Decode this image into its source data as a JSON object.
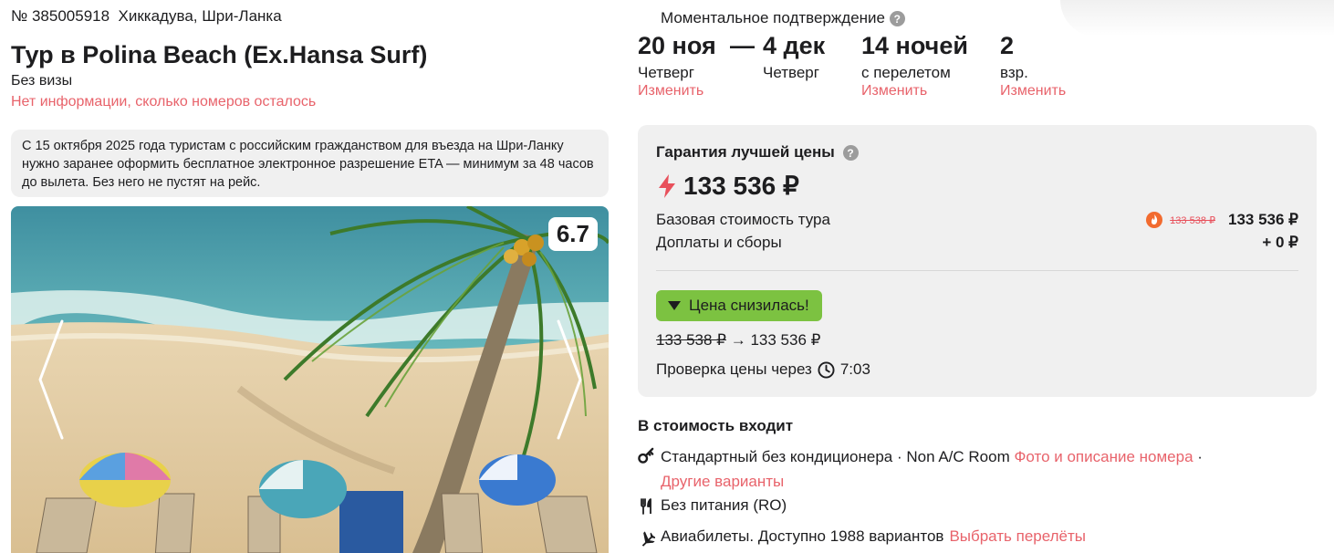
{
  "tour": {
    "number": "№ 385005918",
    "location": "Хиккадува, Шри-Ланка",
    "title": "Тур в Polina Beach (Ex.Hansa Surf)",
    "visa": "Без визы",
    "rooms_info": "Нет информации, сколько номеров осталось",
    "notice": "С 15 октября 2025 года туристам с российским гражданством для въезда на Шри-Ланку нужно заранее оформить бесплатное электронное разрешение ETA — минимум за 48 часов до вылета. Без него не пустят на рейс.",
    "rating": "6.7"
  },
  "dates": {
    "confirmation": "Моментальное подтверждение",
    "from_date": "20 ноя",
    "dash": "—",
    "to_date": "4 дек",
    "from_day": "Четверг",
    "to_day": "Четверг",
    "nights": "14 ночей",
    "nights_sub": "с перелетом",
    "adults": "2",
    "adults_sub": "взр.",
    "change_label": "Изменить"
  },
  "price": {
    "guarantee": "Гарантия лучшей цены",
    "total": "133 536 ₽",
    "base_label": "Базовая стоимость тура",
    "base_old": "133 538 ₽",
    "base_value": "133 536 ₽",
    "fees_label": "Доплаты и сборы",
    "fees_value": "+ 0 ₽",
    "drop_badge": "Цена снизилась!",
    "old": "133 538 ₽",
    "arrow": "→",
    "new": "133 536 ₽",
    "check_label": "Проверка цены через",
    "check_time": "7:03"
  },
  "included": {
    "title": "В стоимость входит",
    "room_text": "Стандартный без кондиционера · Non A/C Room",
    "room_link": "Фото и описание номера",
    "room_sep": "·",
    "room_other": "Другие варианты",
    "meal": "Без питания (RO)",
    "flights_text": "Авиабилеты. Доступно 1988 вариантов",
    "flights_link": "Выбрать перелёты"
  },
  "colors": {
    "accent": "#e8636b",
    "badge_green": "#7cc241",
    "panel_bg": "#f0f0f0",
    "lightning": "#e8505b",
    "fire": "#f26b2f"
  }
}
